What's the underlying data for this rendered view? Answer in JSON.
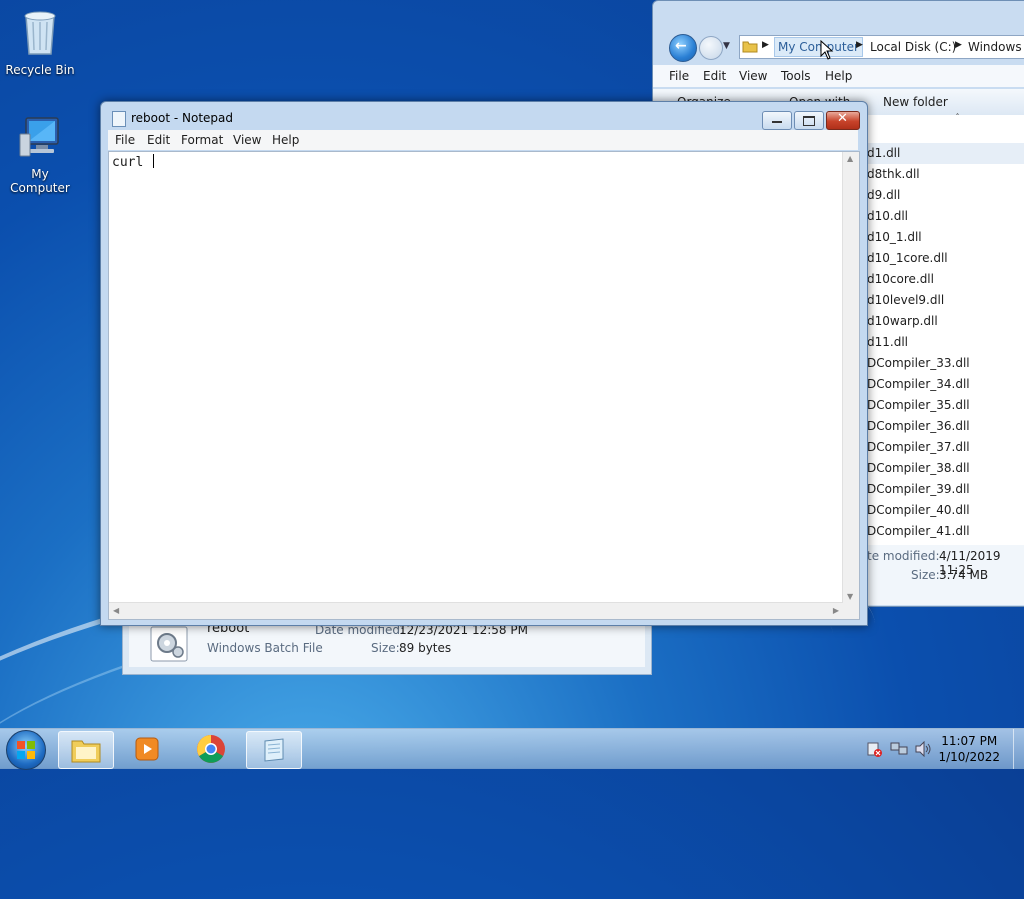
{
  "desktop": {
    "icons": [
      {
        "label": "Recycle Bin"
      },
      {
        "label": "My Computer"
      }
    ]
  },
  "explorer": {
    "breadcrumbs": [
      "My Computer",
      "Local Disk (C:)",
      "Windows"
    ],
    "menu": [
      "File",
      "Edit",
      "View",
      "Tools",
      "Help"
    ],
    "toolbar": {
      "organize": "Organize",
      "open_with": "Open with",
      "new_folder": "New folder"
    },
    "files": [
      "d1.dll",
      "d8thk.dll",
      "d9.dll",
      "d10.dll",
      "d10_1.dll",
      "d10_1core.dll",
      "d10core.dll",
      "d10level9.dll",
      "d10warp.dll",
      "d11.dll",
      "DCompiler_33.dll",
      "DCompiler_34.dll",
      "DCompiler_35.dll",
      "DCompiler_36.dll",
      "DCompiler_37.dll",
      "DCompiler_38.dll",
      "DCompiler_39.dll",
      "DCompiler_40.dll",
      "DCompiler_41.dll"
    ],
    "status": {
      "date_label": "te modified:",
      "date_value": "4/11/2019 11:25",
      "size_label": "Size:",
      "size_value": "3.74 MB"
    }
  },
  "details_behind": {
    "name": "reboot",
    "type": "Windows Batch File",
    "date_label": "Date modified:",
    "date_value": "12/23/2021 12:58 PM",
    "size_label": "Size:",
    "size_value": "89 bytes"
  },
  "notepad": {
    "title": "reboot - Notepad",
    "menu": [
      "File",
      "Edit",
      "Format",
      "View",
      "Help"
    ],
    "content": "curl "
  },
  "taskbar": {
    "time": "11:07 PM",
    "date": "1/10/2022"
  }
}
